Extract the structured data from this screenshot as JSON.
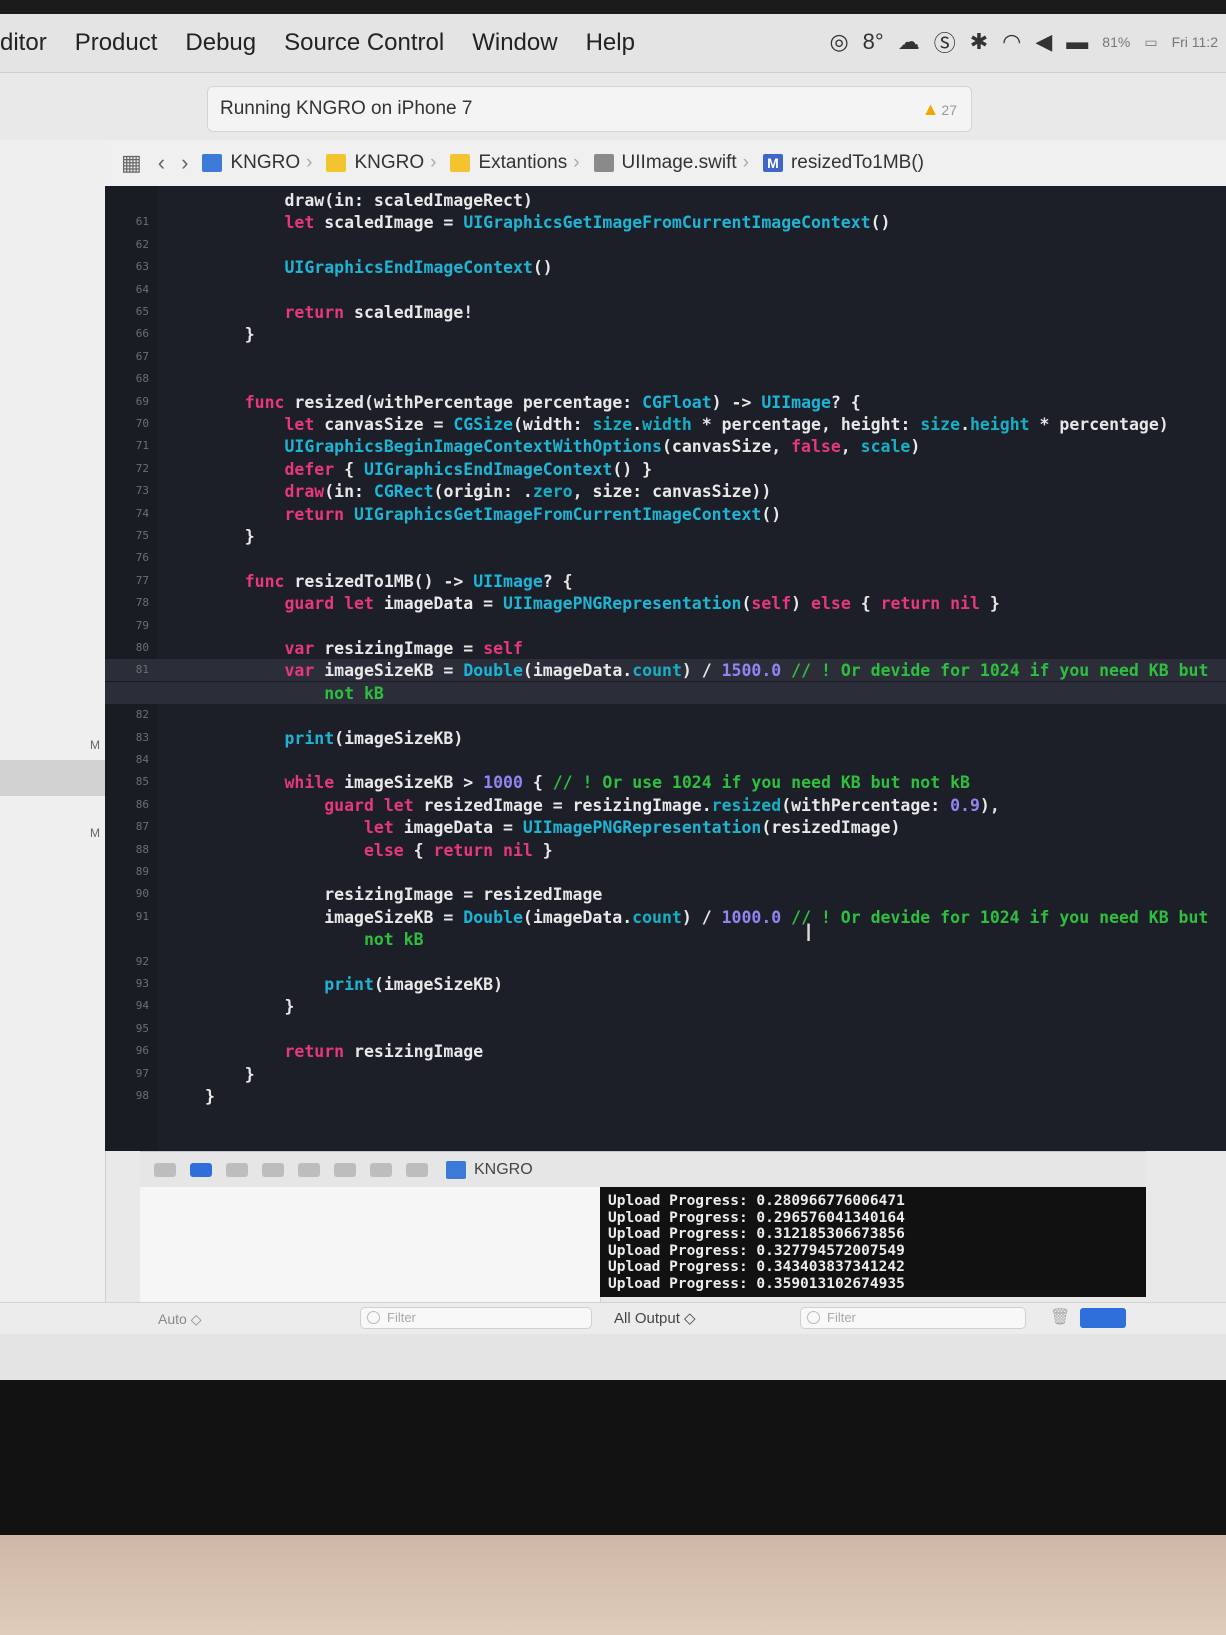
{
  "menubar": {
    "items": [
      "ditor",
      "Product",
      "Debug",
      "Source Control",
      "Window",
      "Help"
    ],
    "temperature": "8°",
    "battery": "81%",
    "clock": "Fri 11:2"
  },
  "activity": {
    "status": "Running KNGRO on iPhone 7",
    "warning_count": "27"
  },
  "jumpbar": {
    "crumbs": [
      "KNGRO",
      "KNGRO",
      "Extantions",
      "UIImage.swift",
      "resizedTo1MB()"
    ],
    "method_badge": "M"
  },
  "sidebar": {
    "markers": [
      "M",
      "M"
    ]
  },
  "editor": {
    "lines": [
      {
        "n": "",
        "t": [
          [
            "p",
            "        draw(in: scaledImageRect)"
          ]
        ]
      },
      {
        "n": "61",
        "t": [
          [
            "p",
            "        "
          ],
          [
            "k",
            "let"
          ],
          [
            "p",
            " scaledImage = "
          ],
          [
            "f",
            "UIGraphicsGetImageFromCurrentImageContext"
          ],
          [
            "p",
            "()"
          ]
        ]
      },
      {
        "n": "62",
        "t": []
      },
      {
        "n": "63",
        "t": [
          [
            "p",
            "        "
          ],
          [
            "f",
            "UIGraphicsEndImageContext"
          ],
          [
            "p",
            "()"
          ]
        ]
      },
      {
        "n": "64",
        "t": []
      },
      {
        "n": "65",
        "t": [
          [
            "p",
            "        "
          ],
          [
            "k",
            "return"
          ],
          [
            "p",
            " scaledImage!"
          ]
        ]
      },
      {
        "n": "66",
        "t": [
          [
            "p",
            "    }"
          ]
        ]
      },
      {
        "n": "67",
        "t": []
      },
      {
        "n": "68",
        "t": []
      },
      {
        "n": "69",
        "t": [
          [
            "p",
            "    "
          ],
          [
            "k",
            "func"
          ],
          [
            "p",
            " resized(withPercentage percentage: "
          ],
          [
            "y",
            "CGFloat"
          ],
          [
            "p",
            ") -> "
          ],
          [
            "y",
            "UIImage"
          ],
          [
            "p",
            "? {"
          ]
        ]
      },
      {
        "n": "70",
        "t": [
          [
            "p",
            "        "
          ],
          [
            "k",
            "let"
          ],
          [
            "p",
            " canvasSize = "
          ],
          [
            "y",
            "CGSize"
          ],
          [
            "p",
            "(width: "
          ],
          [
            "r",
            "size"
          ],
          [
            "p",
            "."
          ],
          [
            "r",
            "width"
          ],
          [
            "p",
            " * percentage, height: "
          ],
          [
            "r",
            "size"
          ],
          [
            "p",
            "."
          ],
          [
            "r",
            "height"
          ],
          [
            "p",
            " * percentage)"
          ]
        ]
      },
      {
        "n": "71",
        "t": [
          [
            "p",
            "        "
          ],
          [
            "f",
            "UIGraphicsBeginImageContextWithOptions"
          ],
          [
            "p",
            "(canvasSize, "
          ],
          [
            "k",
            "false"
          ],
          [
            "p",
            ", "
          ],
          [
            "r",
            "scale"
          ],
          [
            "p",
            ")"
          ]
        ]
      },
      {
        "n": "72",
        "t": [
          [
            "p",
            "        "
          ],
          [
            "k",
            "defer"
          ],
          [
            "p",
            " { "
          ],
          [
            "f",
            "UIGraphicsEndImageContext"
          ],
          [
            "p",
            "() }"
          ]
        ]
      },
      {
        "n": "73",
        "t": [
          [
            "p",
            "        "
          ],
          [
            "k",
            "draw"
          ],
          [
            "p",
            "(in: "
          ],
          [
            "y",
            "CGRect"
          ],
          [
            "p",
            "(origin: ."
          ],
          [
            "r",
            "zero"
          ],
          [
            "p",
            ", size: canvasSize))"
          ]
        ]
      },
      {
        "n": "74",
        "t": [
          [
            "p",
            "        "
          ],
          [
            "k",
            "return"
          ],
          [
            "p",
            " "
          ],
          [
            "f",
            "UIGraphicsGetImageFromCurrentImageContext"
          ],
          [
            "p",
            "()"
          ]
        ]
      },
      {
        "n": "75",
        "t": [
          [
            "p",
            "    }"
          ]
        ]
      },
      {
        "n": "76",
        "t": []
      },
      {
        "n": "77",
        "t": [
          [
            "p",
            "    "
          ],
          [
            "k",
            "func"
          ],
          [
            "p",
            " resizedTo1MB() -> "
          ],
          [
            "y",
            "UIImage"
          ],
          [
            "p",
            "? {"
          ]
        ]
      },
      {
        "n": "78",
        "t": [
          [
            "p",
            "        "
          ],
          [
            "k",
            "guard let"
          ],
          [
            "p",
            " imageData = "
          ],
          [
            "f",
            "UIImagePNGRepresentation"
          ],
          [
            "p",
            "("
          ],
          [
            "k",
            "self"
          ],
          [
            "p",
            ") "
          ],
          [
            "k",
            "else"
          ],
          [
            "p",
            " { "
          ],
          [
            "k",
            "return nil"
          ],
          [
            "p",
            " }"
          ]
        ]
      },
      {
        "n": "79",
        "t": []
      },
      {
        "n": "80",
        "t": [
          [
            "p",
            "        "
          ],
          [
            "k",
            "var"
          ],
          [
            "p",
            " resizingImage = "
          ],
          [
            "k",
            "self"
          ]
        ]
      },
      {
        "n": "81",
        "h": true,
        "t": [
          [
            "p",
            "        "
          ],
          [
            "k",
            "var"
          ],
          [
            "p",
            " imageSizeKB = "
          ],
          [
            "y",
            "Double"
          ],
          [
            "p",
            "(imageData."
          ],
          [
            "r",
            "count"
          ],
          [
            "p",
            ") / "
          ],
          [
            "n",
            "1500.0"
          ],
          [
            "p",
            " "
          ],
          [
            "c",
            "// ! Or devide for 1024 if you need KB but"
          ]
        ]
      },
      {
        "n": "",
        "h": true,
        "t": [
          [
            "c",
            "            not kB"
          ]
        ]
      },
      {
        "n": "82",
        "t": []
      },
      {
        "n": "83",
        "t": [
          [
            "p",
            "        "
          ],
          [
            "f",
            "print"
          ],
          [
            "p",
            "(imageSizeKB)"
          ]
        ]
      },
      {
        "n": "84",
        "t": []
      },
      {
        "n": "85",
        "t": [
          [
            "p",
            "        "
          ],
          [
            "k",
            "while"
          ],
          [
            "p",
            " imageSizeKB > "
          ],
          [
            "n",
            "1000"
          ],
          [
            "p",
            " { "
          ],
          [
            "c",
            "// ! Or use 1024 if you need KB but not kB"
          ]
        ]
      },
      {
        "n": "86",
        "t": [
          [
            "p",
            "            "
          ],
          [
            "k",
            "guard let"
          ],
          [
            "p",
            " resizedImage = resizingImage."
          ],
          [
            "r",
            "resized"
          ],
          [
            "p",
            "(withPercentage: "
          ],
          [
            "n",
            "0.9"
          ],
          [
            "p",
            "),"
          ]
        ]
      },
      {
        "n": "87",
        "t": [
          [
            "p",
            "                "
          ],
          [
            "k",
            "let"
          ],
          [
            "p",
            " imageData = "
          ],
          [
            "f",
            "UIImagePNGRepresentation"
          ],
          [
            "p",
            "(resizedImage)"
          ]
        ]
      },
      {
        "n": "88",
        "t": [
          [
            "p",
            "                "
          ],
          [
            "k",
            "else"
          ],
          [
            "p",
            " { "
          ],
          [
            "k",
            "return nil"
          ],
          [
            "p",
            " }"
          ]
        ]
      },
      {
        "n": "89",
        "t": []
      },
      {
        "n": "90",
        "t": [
          [
            "p",
            "            resizingImage = resizedImage"
          ]
        ]
      },
      {
        "n": "91",
        "t": [
          [
            "p",
            "            imageSizeKB = "
          ],
          [
            "y",
            "Double"
          ],
          [
            "p",
            "(imageData."
          ],
          [
            "r",
            "count"
          ],
          [
            "p",
            ") / "
          ],
          [
            "n",
            "1000.0"
          ],
          [
            "p",
            " "
          ],
          [
            "c",
            "// ! Or devide for 1024 if you need KB but"
          ]
        ]
      },
      {
        "n": "",
        "t": [
          [
            "c",
            "                not kB"
          ]
        ]
      },
      {
        "n": "92",
        "t": []
      },
      {
        "n": "93",
        "t": [
          [
            "p",
            "            "
          ],
          [
            "f",
            "print"
          ],
          [
            "p",
            "(imageSizeKB)"
          ]
        ]
      },
      {
        "n": "94",
        "t": [
          [
            "p",
            "        }"
          ]
        ]
      },
      {
        "n": "95",
        "t": []
      },
      {
        "n": "96",
        "t": [
          [
            "p",
            "        "
          ],
          [
            "k",
            "return"
          ],
          [
            "p",
            " resizingImage"
          ]
        ]
      },
      {
        "n": "97",
        "t": [
          [
            "p",
            "    }"
          ]
        ]
      },
      {
        "n": "98",
        "t": [
          [
            "p",
            "}"
          ]
        ]
      }
    ]
  },
  "debugbar": {
    "target": "KNGRO"
  },
  "console": {
    "lines": [
      "Upload Progress: 0.280966776006471",
      "Upload Progress: 0.296576041340164",
      "Upload Progress: 0.312185306673856",
      "Upload Progress: 0.327794572007549",
      "Upload Progress: 0.343403837341242",
      "Upload Progress: 0.359013102674935"
    ]
  },
  "footer": {
    "auto_label": "Auto ◇",
    "filter_placeholder": "Filter",
    "output_label": "All Output ◇"
  },
  "colors": {
    "editor_bg": "#1d1f28",
    "keyword": "#e6377f",
    "type": "#19b6d8",
    "number": "#8f86f2",
    "comment": "#2fbf3f",
    "accent": "#2f6fdb"
  }
}
